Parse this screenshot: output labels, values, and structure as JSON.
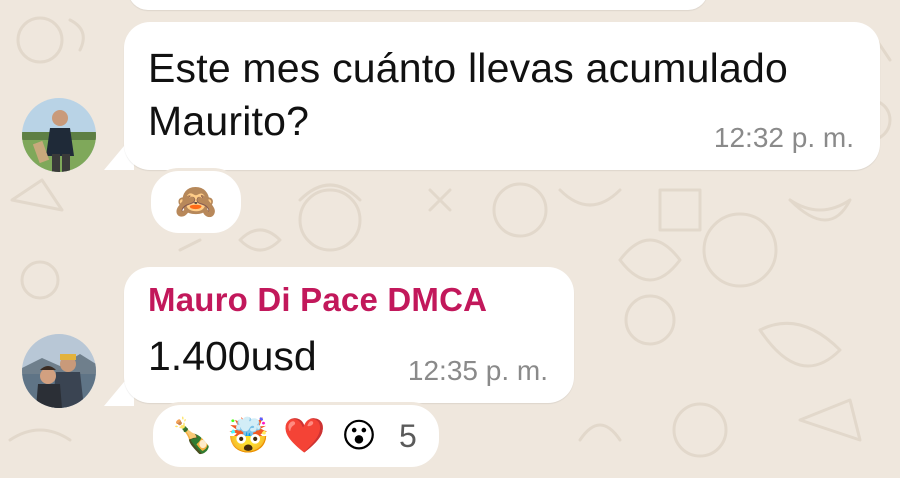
{
  "messages": [
    {
      "text": "Este mes cuánto llevas acumulado Maurito?",
      "time": "12:32 p. m.",
      "reactions": [
        "🙈"
      ]
    },
    {
      "sender": "Mauro Di Pace DMCA",
      "sender_color": "#c2185b",
      "text": "1.400usd",
      "time": "12:35 p. m.",
      "reactions": [
        "🍾",
        "🤯",
        "❤️",
        "😮"
      ],
      "reaction_count": "5"
    }
  ],
  "colors": {
    "wallpaper": "#efe7dd",
    "bubble": "#ffffff",
    "timestamp": "#8a8a8a"
  }
}
